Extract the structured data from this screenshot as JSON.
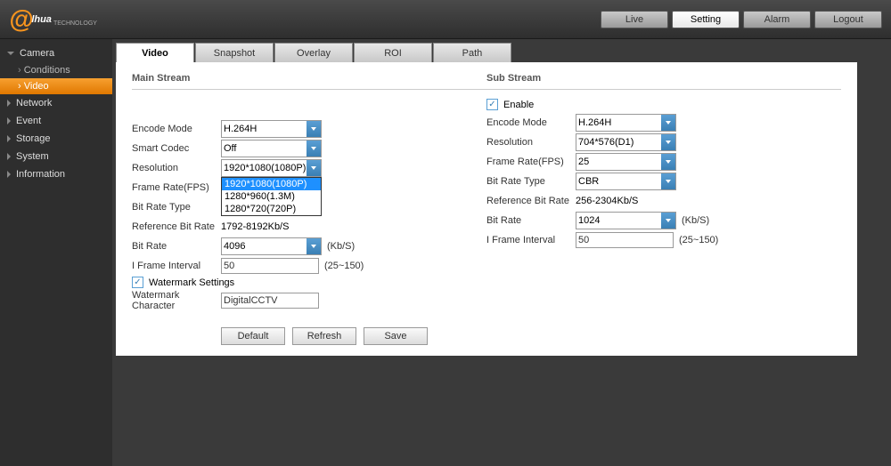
{
  "brand": {
    "name": "alhua",
    "sub": "TECHNOLOGY"
  },
  "nav": {
    "live": "Live",
    "setting": "Setting",
    "alarm": "Alarm",
    "logout": "Logout"
  },
  "sidebar": {
    "camera": "Camera",
    "conditions": "Conditions",
    "video": "Video",
    "network": "Network",
    "event": "Event",
    "storage": "Storage",
    "system": "System",
    "information": "Information"
  },
  "tabs": {
    "video": "Video",
    "snapshot": "Snapshot",
    "overlay": "Overlay",
    "roi": "ROI",
    "path": "Path"
  },
  "main_stream": {
    "title": "Main Stream",
    "encode_mode_label": "Encode Mode",
    "encode_mode": "H.264H",
    "smart_codec_label": "Smart Codec",
    "smart_codec": "Off",
    "resolution_label": "Resolution",
    "resolution": "1920*1080(1080P)",
    "resolution_options": [
      "1920*1080(1080P)",
      "1280*960(1.3M)",
      "1280*720(720P)"
    ],
    "fps_label": "Frame Rate(FPS)",
    "brtype_label": "Bit Rate Type",
    "ref_br_label": "Reference Bit Rate",
    "ref_br": "1792-8192Kb/S",
    "br_label": "Bit Rate",
    "br": "4096",
    "br_unit": "(Kb/S)",
    "iframe_label": "I Frame Interval",
    "iframe": "50",
    "iframe_hint": "(25~150)",
    "watermark_label": "Watermark Settings",
    "wm_char_label": "Watermark Character",
    "wm_char": "DigitalCCTV"
  },
  "sub_stream": {
    "title": "Sub Stream",
    "enable_label": "Enable",
    "encode_mode_label": "Encode Mode",
    "encode_mode": "H.264H",
    "resolution_label": "Resolution",
    "resolution": "704*576(D1)",
    "fps_label": "Frame Rate(FPS)",
    "fps": "25",
    "brtype_label": "Bit Rate Type",
    "brtype": "CBR",
    "ref_br_label": "Reference Bit Rate",
    "ref_br": "256-2304Kb/S",
    "br_label": "Bit Rate",
    "br": "1024",
    "br_unit": "(Kb/S)",
    "iframe_label": "I Frame Interval",
    "iframe": "50",
    "iframe_hint": "(25~150)"
  },
  "actions": {
    "default": "Default",
    "refresh": "Refresh",
    "save": "Save"
  }
}
